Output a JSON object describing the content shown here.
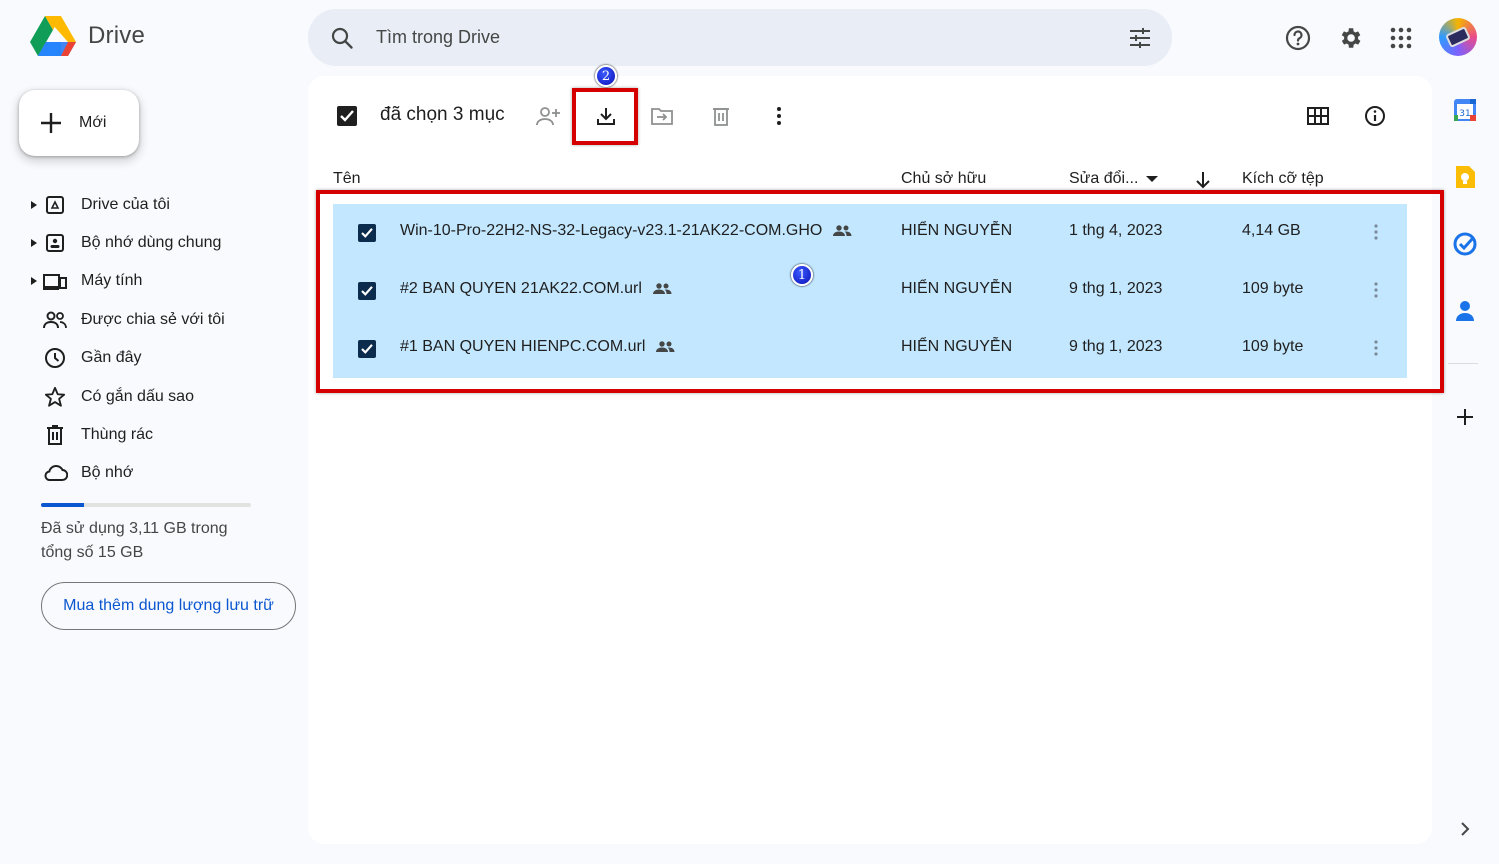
{
  "app": {
    "name": "Drive"
  },
  "search": {
    "placeholder": "Tìm trong Drive"
  },
  "new_button": {
    "label": "Mới"
  },
  "sidebar": {
    "items": [
      {
        "label": "Drive của tôi",
        "icon": "my-drive-icon",
        "expandable": true
      },
      {
        "label": "Bộ nhớ dùng chung",
        "icon": "shared-drives-icon",
        "expandable": true
      },
      {
        "label": "Máy tính",
        "icon": "computers-icon",
        "expandable": true
      },
      {
        "label": "Được chia sẻ với tôi",
        "icon": "people-icon",
        "expandable": false
      },
      {
        "label": "Gần đây",
        "icon": "clock-icon",
        "expandable": false
      },
      {
        "label": "Có gắn dấu sao",
        "icon": "star-icon",
        "expandable": false
      },
      {
        "label": "Thùng rác",
        "icon": "trash-icon",
        "expandable": false
      },
      {
        "label": "Bộ nhớ",
        "icon": "cloud-icon",
        "expandable": false
      }
    ],
    "storage": {
      "used_text": "Đã sử dụng 3,11 GB trong tổng số 15 GB",
      "used_fraction": 0.207
    },
    "buy_storage_label": "Mua thêm dung lượng lưu trữ"
  },
  "toolbar": {
    "selected_label": "đã chọn 3 mục"
  },
  "table": {
    "headers": {
      "name": "Tên",
      "owner": "Chủ sở hữu",
      "modified": "Sửa đổi...",
      "size": "Kích cỡ tệp"
    },
    "rows": [
      {
        "name": "Win-10-Pro-22H2-NS-32-Legacy-v23.1-21AK22-COM.GHO",
        "owner": "HIỂN NGUYỄN",
        "modified": "1 thg 4, 2023",
        "size": "4,14 GB",
        "shared": true
      },
      {
        "name": "#2 BAN QUYEN 21AK22.COM.url",
        "owner": "HIỂN NGUYỄN",
        "modified": "9 thg 1, 2023",
        "size": "109 byte",
        "shared": true
      },
      {
        "name": "#1 BAN QUYEN HIENPC.COM.url",
        "owner": "HIỂN NGUYỄN",
        "modified": "9 thg 1, 2023",
        "size": "109 byte",
        "shared": true
      }
    ]
  },
  "annotations": {
    "badge_1": "1",
    "badge_2": "2"
  },
  "colors": {
    "accent": "#0b57d0",
    "selected_row": "#c2e7ff",
    "highlight": "#d50000",
    "search_bg": "#e9eef6"
  }
}
